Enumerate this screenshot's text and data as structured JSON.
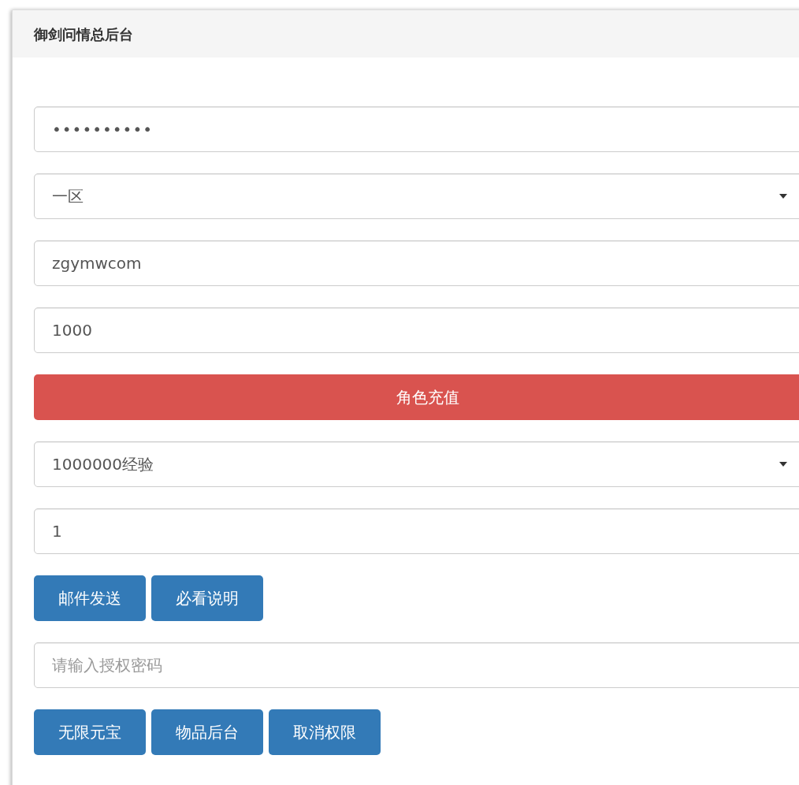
{
  "panel": {
    "title": "御剑问情总后台"
  },
  "items": [
    {
      "kind": "password",
      "value": "••••••••••"
    },
    {
      "kind": "select",
      "value": "一区"
    },
    {
      "kind": "text",
      "value": "zgymwcom"
    },
    {
      "kind": "text",
      "value": "1000"
    },
    {
      "kind": "danger_button",
      "label": "角色充值"
    },
    {
      "kind": "select",
      "value": "1000000经验"
    },
    {
      "kind": "text",
      "value": "1"
    },
    {
      "kind": "button_row",
      "buttons": [
        "邮件发送",
        "必看说明"
      ]
    },
    {
      "kind": "input",
      "placeholder": "请输入授权密码"
    },
    {
      "kind": "button_row",
      "buttons": [
        "无限元宝",
        "物品后台",
        "取消权限"
      ]
    }
  ]
}
